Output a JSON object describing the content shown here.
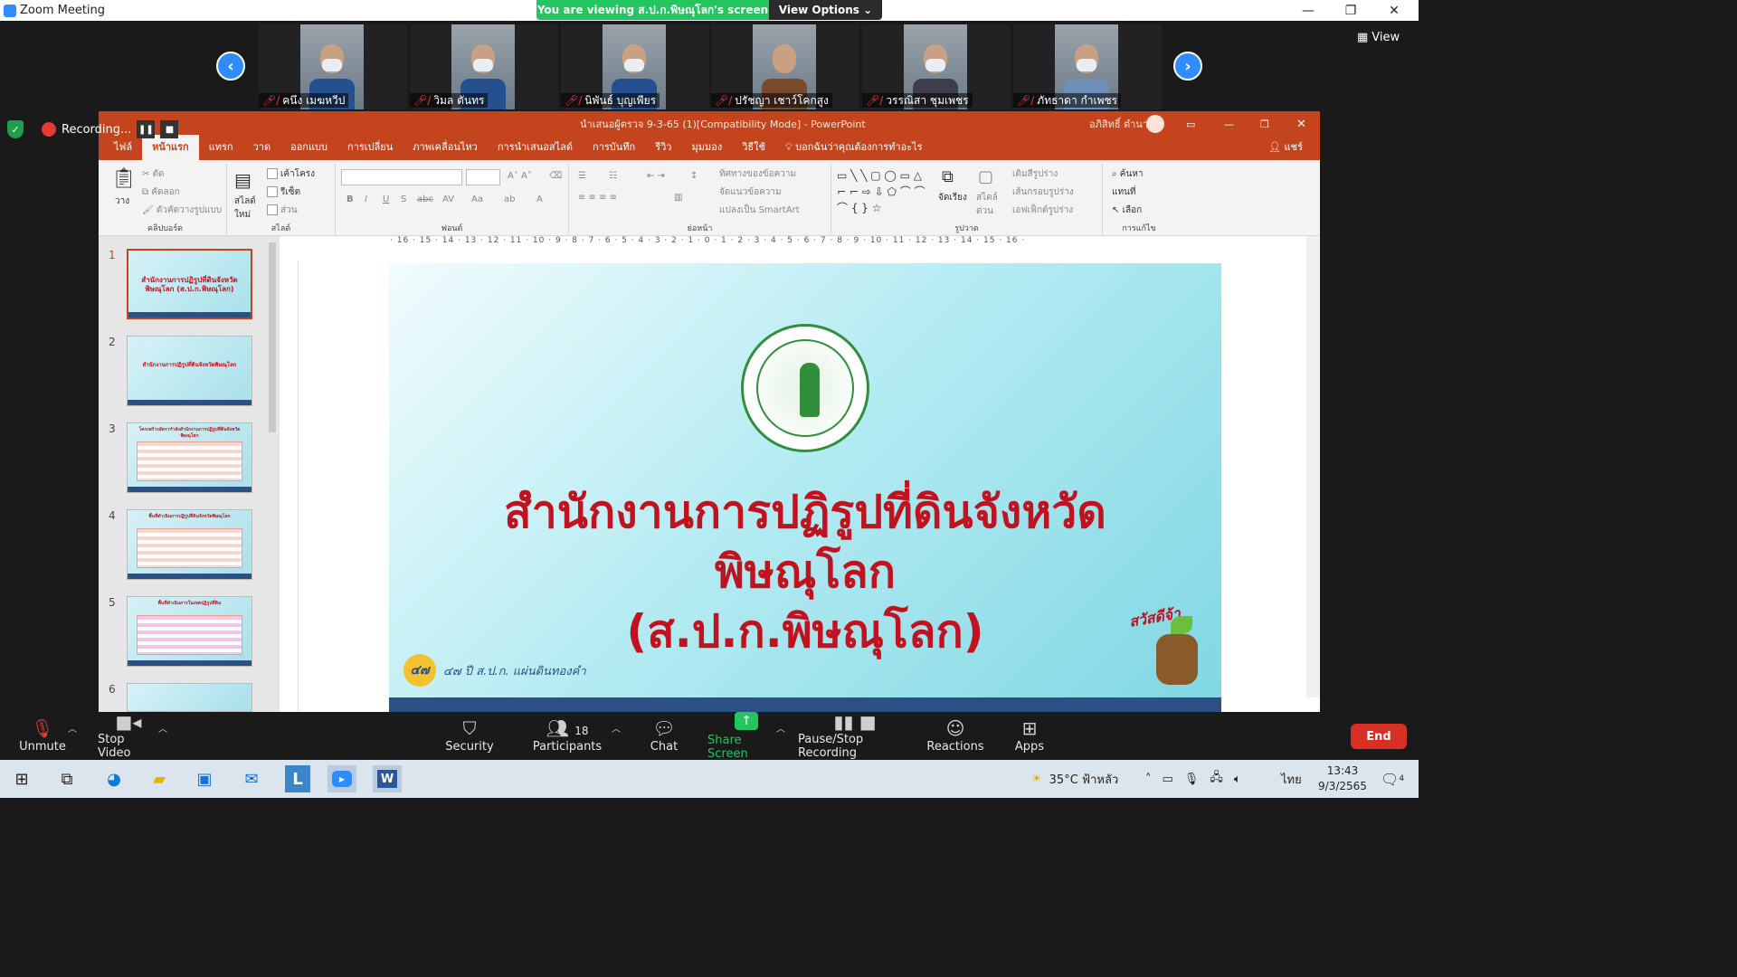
{
  "window": {
    "title": "Zoom Meeting",
    "viewing_banner": "You are viewing ส.ป.ก.พิษณุโลก's screen",
    "view_options": "View Options",
    "view_label": "View"
  },
  "participants_strip": [
    {
      "name": "คนึง เมฆหวีป"
    },
    {
      "name": "วิมล ตันทร"
    },
    {
      "name": "นิพันธ์ บุญเพียร"
    },
    {
      "name": "ปรัชญา เชาว์โคกสูง"
    },
    {
      "name": "วรรณิสา ชุมเพชร"
    },
    {
      "name": "ภัทธาดา กำเพชร"
    }
  ],
  "recording": {
    "label": "Recording..."
  },
  "ppt": {
    "title": "นำเสนอผู้ตรวจ 9-3-65 (1)[Compatibility Mode] - PowerPoint",
    "user": "อภิสิทธิ์ ตำนาน",
    "share": "แชร์",
    "tell_me": "บอกฉันว่าคุณต้องการทำอะไร",
    "tabs": [
      "ไฟล์",
      "หน้าแรก",
      "แทรก",
      "วาด",
      "ออกแบบ",
      "การเปลี่ยน",
      "ภาพเคลื่อนไหว",
      "การนำเสนอสไลด์",
      "การบันทึก",
      "รีวิว",
      "มุมมอง",
      "วิธีใช้"
    ],
    "ribbon": {
      "paste": "วาง",
      "cut": "ตัด",
      "copy": "คัดลอก",
      "format_painter": "ตัวคัดวางรูปแบบ",
      "clipboard": "คลิปบอร์ด",
      "new_slide": "สไลด์ใหม่",
      "layout": "เค้าโครง",
      "reset": "รีเซ็ต",
      "section": "ส่วน",
      "slides": "สไลด์",
      "font": "ฟอนต์",
      "paragraph": "ย่อหน้า",
      "text_direction": "ทิศทางของข้อความ",
      "align_text": "จัดแนวข้อความ",
      "smartart": "แปลงเป็น SmartArt",
      "arrange": "จัดเรียง",
      "quick_styles": "สไตล์ด่วน",
      "shape_fill": "เติมสีรูปร่าง",
      "shape_outline": "เส้นกรอบรูปร่าง",
      "shape_effects": "เอฟเฟ็กต์รูปร่าง",
      "drawing": "รูปวาด",
      "find": "ค้นหา",
      "replace": "แทนที่",
      "select": "เลือก",
      "editing": "การแก้ไข"
    },
    "thumbnails": [
      {
        "num": "1",
        "title": "สำนักงานการปฏิรูปที่ดินจังหวัดพิษณุโลก (ส.ป.ก.พิษณุโลก)"
      },
      {
        "num": "2",
        "title": "สำนักงานการปฏิรูปที่ดินจังหวัดพิษณุโลก"
      },
      {
        "num": "3",
        "title": "โครงสร้างอัตรากำลังสำนักงานการปฏิรูปที่ดินจังหวัดพิษณุโลก"
      },
      {
        "num": "4",
        "title": "พื้นที่ดำเนินการปฏิรูปที่ดินจังหวัดพิษณุโลก"
      },
      {
        "num": "5",
        "title": "พื้นที่ดำเนินการในเขตปฏิรูปที่ดิน"
      },
      {
        "num": "6",
        "title": ""
      }
    ],
    "hruler": "· 16 · 15 · 14 · 13 · 12 · 11 · 10 · 9 · 8 · 7 · 6 · 5 · 4 · 3 · 2 · 1 · 0 · 1 · 2 · 3 · 4 · 5 · 6 · 7 · 8 · 9 · 10 · 11 · 12 · 13 · 14 · 15 · 16 ·",
    "slide": {
      "title_line1": "สำนักงานการปฏิรูปที่ดินจังหวัด",
      "title_line2": "พิษณุโลก",
      "title_line3": "(ส.ป.ก.พิษณุโลก)",
      "anniversary_badge": "๔๗",
      "anniversary_text": "๔๗ ปี ส.ป.ก. แผ่นดินทองคำ",
      "mascot_greeting": "สวัสดีจ้า"
    }
  },
  "toolbar": {
    "unmute": "Unmute",
    "stop_video": "Stop Video",
    "security": "Security",
    "participants": "Participants",
    "participants_count": "18",
    "chat": "Chat",
    "share_screen": "Share Screen",
    "pause_stop_recording": "Pause/Stop Recording",
    "reactions": "Reactions",
    "apps": "Apps",
    "end": "End"
  },
  "taskbar": {
    "weather": "35°C ฟ้าหลัว",
    "lang": "ไทย",
    "time": "13:43",
    "date": "9/3/2565",
    "notif_count": "4"
  }
}
